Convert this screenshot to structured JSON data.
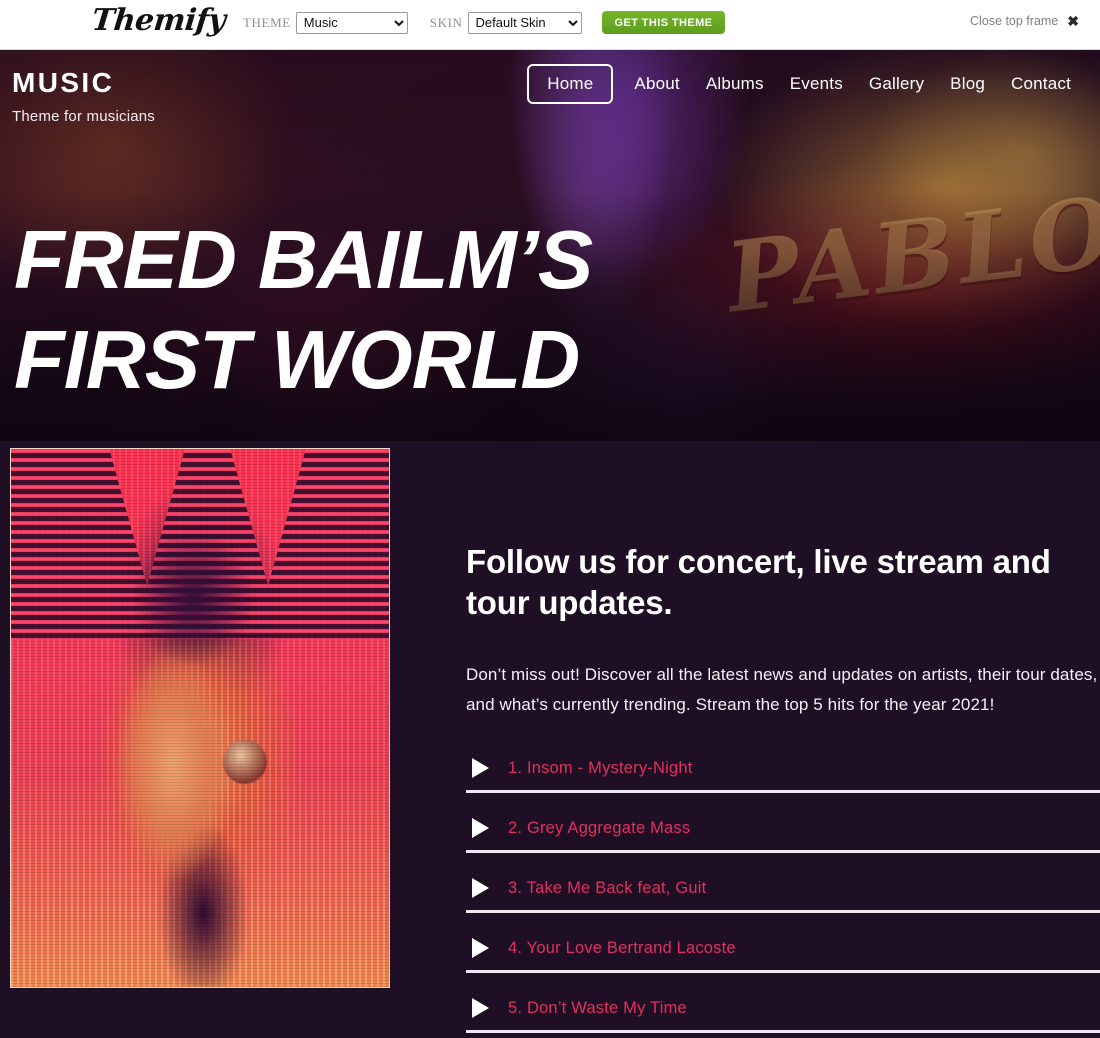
{
  "topbar": {
    "logo": "Themify",
    "theme_label": "THEME",
    "theme_value": "Music",
    "theme_options": [
      "Music"
    ],
    "skin_label": "SKIN",
    "skin_value": "Default Skin",
    "skin_options": [
      "Default Skin"
    ],
    "cta_label": "GET THIS THEME",
    "close_label": "Close top frame",
    "close_icon": "close-x-icon",
    "cta_color": "#67ab20"
  },
  "site": {
    "title": "MUSIC",
    "tagline": "Theme for musicians",
    "sign_text": "PABLO",
    "nav": [
      {
        "label": "Home",
        "current": true
      },
      {
        "label": "About",
        "current": false
      },
      {
        "label": "Albums",
        "current": false
      },
      {
        "label": "Events",
        "current": false
      },
      {
        "label": "Gallery",
        "current": false
      },
      {
        "label": "Blog",
        "current": false
      },
      {
        "label": "Contact",
        "current": false
      }
    ],
    "hero_headline": "Fred Bailm’s First World"
  },
  "main": {
    "heading": "Follow us for concert, live stream and tour updates.",
    "paragraph": "Don’t miss out! Discover all the latest news and updates on artists, their tour dates, and what’s currently trending. Stream the top 5 hits for the year 2021!",
    "image_alt": "singer-performing-photo",
    "tracks": [
      {
        "label": "1. Insom - Mystery-Night"
      },
      {
        "label": "2. Grey Aggregate Mass"
      },
      {
        "label": "3. Take Me Back feat, Guit"
      },
      {
        "label": "4. Your Love Bertrand Lacoste"
      },
      {
        "label": "5. Don’t Waste My Time"
      }
    ],
    "colors": {
      "background": "#1e0f24",
      "track_text": "#e23060",
      "divider": "#efe6ef",
      "heading": "#ffffff"
    }
  }
}
